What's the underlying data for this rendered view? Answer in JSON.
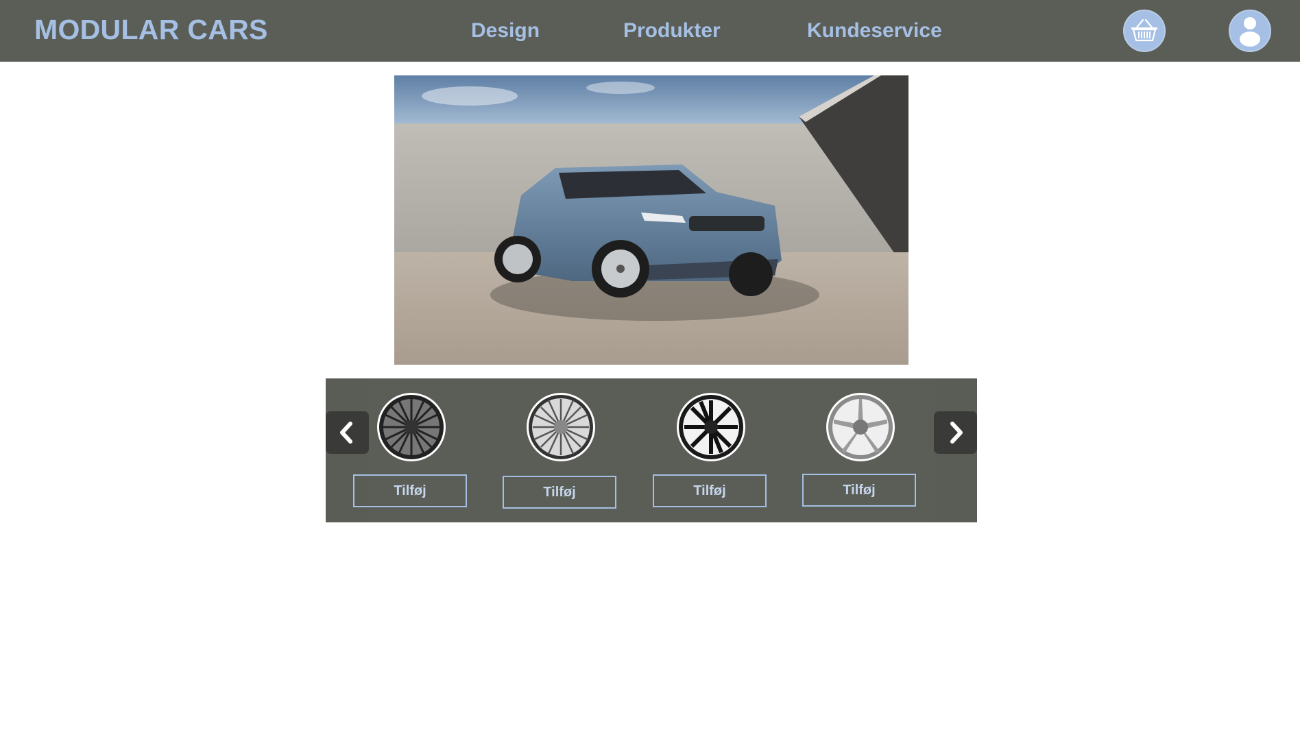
{
  "header": {
    "brand": "MODULAR CARS",
    "nav": [
      {
        "label": "Design"
      },
      {
        "label": "Produkter"
      },
      {
        "label": "Kundeservice"
      }
    ],
    "icons": {
      "cart": "basket-icon",
      "account": "user-icon"
    }
  },
  "hero": {
    "image": "suv-photo"
  },
  "carousel": {
    "prev_icon": "chevron-left-icon",
    "next_icon": "chevron-right-icon",
    "items": [
      {
        "wheel": "wheel-mesh-black-icon",
        "button_label": "Tilføj"
      },
      {
        "wheel": "wheel-multispoke-silver-icon",
        "button_label": "Tilføj"
      },
      {
        "wheel": "wheel-spoke-black-icon",
        "button_label": "Tilføj"
      },
      {
        "wheel": "wheel-five-spoke-silver-icon",
        "button_label": "Tilføj"
      }
    ]
  },
  "colors": {
    "header_bg": "#5b5e57",
    "accent": "#a5c0e4",
    "page_bg": "#ffffff"
  }
}
